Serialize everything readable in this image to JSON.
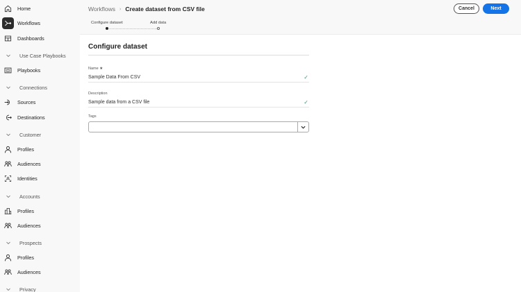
{
  "sidebar": {
    "items": [
      {
        "label": "Home",
        "icon": "home-icon",
        "type": "item"
      },
      {
        "label": "Workflows",
        "icon": "workflow-icon",
        "type": "item",
        "active": true
      },
      {
        "label": "Dashboards",
        "icon": "dashboard-icon",
        "type": "item"
      },
      {
        "label": "Use Case Playbooks",
        "icon": "chevron-down-icon",
        "type": "section"
      },
      {
        "label": "Playbooks",
        "icon": "playbook-icon",
        "type": "item"
      },
      {
        "label": "Connections",
        "icon": "chevron-down-icon",
        "type": "section"
      },
      {
        "label": "Sources",
        "icon": "sources-icon",
        "type": "item"
      },
      {
        "label": "Destinations",
        "icon": "destinations-icon",
        "type": "item"
      },
      {
        "label": "Customer",
        "icon": "chevron-down-icon",
        "type": "section"
      },
      {
        "label": "Profiles",
        "icon": "profile-icon",
        "type": "item"
      },
      {
        "label": "Audiences",
        "icon": "audiences-icon",
        "type": "item"
      },
      {
        "label": "Identities",
        "icon": "identities-icon",
        "type": "item"
      },
      {
        "label": "Accounts",
        "icon": "chevron-down-icon",
        "type": "section"
      },
      {
        "label": "Profiles",
        "icon": "building-icon",
        "type": "item"
      },
      {
        "label": "Audiences",
        "icon": "audiences-icon",
        "type": "item"
      },
      {
        "label": "Prospects",
        "icon": "chevron-down-icon",
        "type": "section"
      },
      {
        "label": "Profiles",
        "icon": "profile-icon",
        "type": "item"
      },
      {
        "label": "Audiences",
        "icon": "audiences-icon",
        "type": "item"
      },
      {
        "label": "Privacy",
        "icon": "chevron-down-icon",
        "type": "section"
      }
    ]
  },
  "header": {
    "breadcrumb_parent": "Workflows",
    "breadcrumb_current": "Create dataset from CSV file",
    "cancel_label": "Cancel",
    "next_label": "Next",
    "steps": [
      {
        "label": "Configure dataset",
        "done": true
      },
      {
        "label": "Add data",
        "done": false
      }
    ]
  },
  "form": {
    "title": "Configure dataset",
    "name_label": "Name",
    "name_required": "★",
    "name_value": "Sample Data From CSV",
    "description_label": "Description",
    "description_value": "Sample data from a CSV file",
    "tags_label": "Tags",
    "tags_value": ""
  },
  "colors": {
    "accent": "#1473e6",
    "valid": "#2d9d78"
  }
}
